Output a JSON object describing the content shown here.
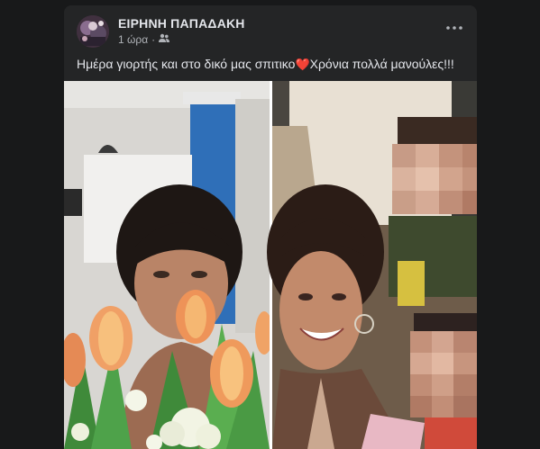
{
  "post": {
    "author": "ΕΙΡΗΝΗ ΠΑΠΑΔΑΚΗ",
    "time": "1 ώρα",
    "audience_icon": "friends-icon",
    "more_icon": "more-options-icon",
    "text_before_emoji": "Ημέρα γιορτής και στο δικό μας σπιτικο",
    "emoji": "❤️",
    "text_after_emoji": "Χρόνια πολλά μανούλες!!!"
  },
  "photo": {
    "layout": "side-by-side collage",
    "left_photo": "woman holding orange tulips",
    "right_photo": "smiling woman with pixelated faces of children"
  },
  "colors": {
    "page_bg": "#18191a",
    "card_bg": "#242526",
    "primary_text": "#e4e6eb",
    "secondary_text": "#b0b3b8",
    "heart": "#e41e3f"
  }
}
